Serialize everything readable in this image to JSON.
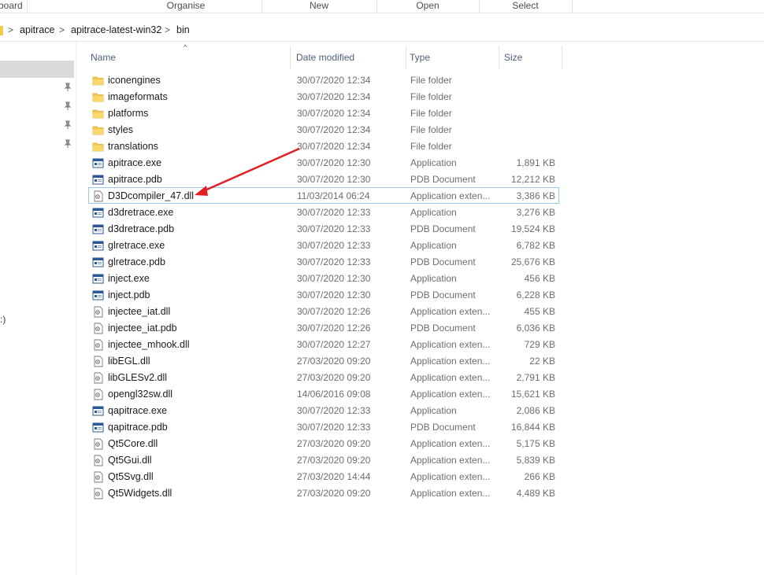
{
  "ribbon": {
    "groups": [
      "board",
      "Organise",
      "New",
      "Open",
      "Select"
    ]
  },
  "address": {
    "crumbs": [
      "apitrace",
      "apitrace-latest-win32",
      "bin"
    ],
    "separator": ">"
  },
  "nav": {
    "drive_fragment": ":)"
  },
  "columns": {
    "name": "Name",
    "date": "Date modified",
    "type": "Type",
    "size": "Size"
  },
  "files": [
    {
      "name": "iconengines",
      "date": "30/07/2020 12:34",
      "type": "File folder",
      "size": "",
      "icon": "folder"
    },
    {
      "name": "imageformats",
      "date": "30/07/2020 12:34",
      "type": "File folder",
      "size": "",
      "icon": "folder"
    },
    {
      "name": "platforms",
      "date": "30/07/2020 12:34",
      "type": "File folder",
      "size": "",
      "icon": "folder"
    },
    {
      "name": "styles",
      "date": "30/07/2020 12:34",
      "type": "File folder",
      "size": "",
      "icon": "folder"
    },
    {
      "name": "translations",
      "date": "30/07/2020 12:34",
      "type": "File folder",
      "size": "",
      "icon": "folder"
    },
    {
      "name": "apitrace.exe",
      "date": "30/07/2020 12:30",
      "type": "Application",
      "size": "1,891 KB",
      "icon": "app"
    },
    {
      "name": "apitrace.pdb",
      "date": "30/07/2020 12:30",
      "type": "PDB Document",
      "size": "12,212 KB",
      "icon": "app"
    },
    {
      "name": "D3Dcompiler_47.dll",
      "date": "11/03/2014 06:24",
      "type": "Application exten...",
      "size": "3,386 KB",
      "icon": "dll"
    },
    {
      "name": "d3dretrace.exe",
      "date": "30/07/2020 12:33",
      "type": "Application",
      "size": "3,276 KB",
      "icon": "app"
    },
    {
      "name": "d3dretrace.pdb",
      "date": "30/07/2020 12:33",
      "type": "PDB Document",
      "size": "19,524 KB",
      "icon": "app"
    },
    {
      "name": "glretrace.exe",
      "date": "30/07/2020 12:33",
      "type": "Application",
      "size": "6,782 KB",
      "icon": "app"
    },
    {
      "name": "glretrace.pdb",
      "date": "30/07/2020 12:33",
      "type": "PDB Document",
      "size": "25,676 KB",
      "icon": "app"
    },
    {
      "name": "inject.exe",
      "date": "30/07/2020 12:30",
      "type": "Application",
      "size": "456 KB",
      "icon": "app"
    },
    {
      "name": "inject.pdb",
      "date": "30/07/2020 12:30",
      "type": "PDB Document",
      "size": "6,228 KB",
      "icon": "app"
    },
    {
      "name": "injectee_iat.dll",
      "date": "30/07/2020 12:26",
      "type": "Application exten...",
      "size": "455 KB",
      "icon": "dll"
    },
    {
      "name": "injectee_iat.pdb",
      "date": "30/07/2020 12:26",
      "type": "PDB Document",
      "size": "6,036 KB",
      "icon": "dll"
    },
    {
      "name": "injectee_mhook.dll",
      "date": "30/07/2020 12:27",
      "type": "Application exten...",
      "size": "729 KB",
      "icon": "dll"
    },
    {
      "name": "libEGL.dll",
      "date": "27/03/2020 09:20",
      "type": "Application exten...",
      "size": "22 KB",
      "icon": "dll"
    },
    {
      "name": "libGLESv2.dll",
      "date": "27/03/2020 09:20",
      "type": "Application exten...",
      "size": "2,791 KB",
      "icon": "dll"
    },
    {
      "name": "opengl32sw.dll",
      "date": "14/06/2016 09:08",
      "type": "Application exten...",
      "size": "15,621 KB",
      "icon": "dll"
    },
    {
      "name": "qapitrace.exe",
      "date": "30/07/2020 12:33",
      "type": "Application",
      "size": "2,086 KB",
      "icon": "app"
    },
    {
      "name": "qapitrace.pdb",
      "date": "30/07/2020 12:33",
      "type": "PDB Document",
      "size": "16,844 KB",
      "icon": "app"
    },
    {
      "name": "Qt5Core.dll",
      "date": "27/03/2020 09:20",
      "type": "Application exten...",
      "size": "5,175 KB",
      "icon": "dll"
    },
    {
      "name": "Qt5Gui.dll",
      "date": "27/03/2020 09:20",
      "type": "Application exten...",
      "size": "5,839 KB",
      "icon": "dll"
    },
    {
      "name": "Qt5Svg.dll",
      "date": "27/03/2020 14:44",
      "type": "Application exten...",
      "size": "266 KB",
      "icon": "dll"
    },
    {
      "name": "Qt5Widgets.dll",
      "date": "27/03/2020 09:20",
      "type": "Application exten...",
      "size": "4,489 KB",
      "icon": "dll"
    }
  ],
  "highlighted_index": 7,
  "colors": {
    "folder": "#f3c94c",
    "header_text": "#4c607a",
    "annotation_arrow": "#e02020",
    "highlight_border": "#99c9ef"
  }
}
